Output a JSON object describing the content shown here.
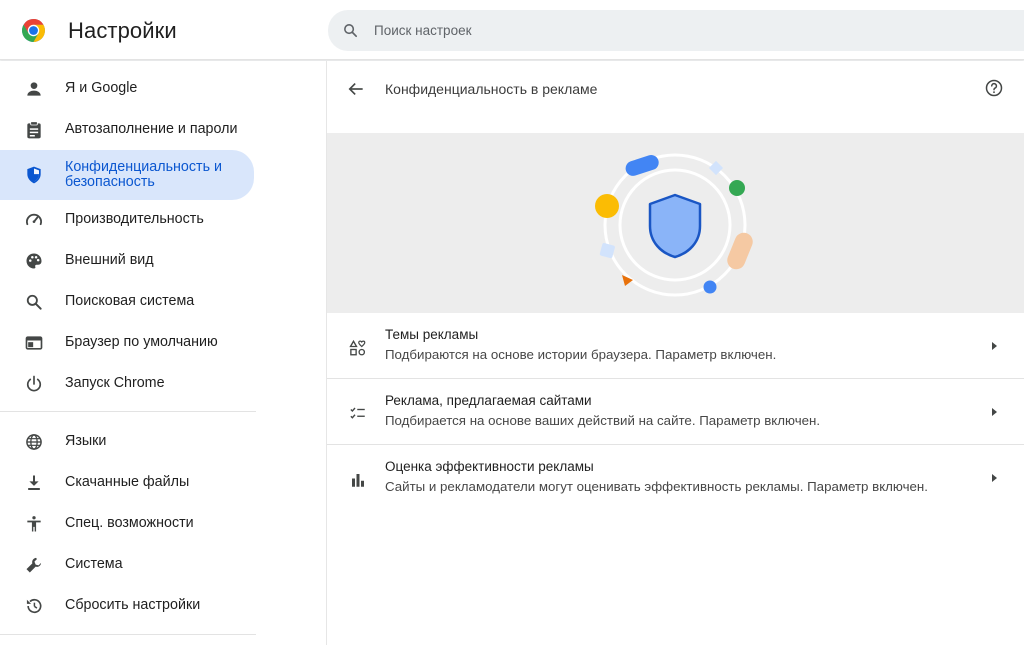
{
  "header": {
    "title": "Настройки",
    "search_placeholder": "Поиск настроек"
  },
  "sidebar": {
    "items": [
      {
        "label": "Я и Google",
        "icon": "person-icon"
      },
      {
        "label": "Автозаполнение и пароли",
        "icon": "clipboard-icon"
      },
      {
        "label": "Конфиденциальность и безопасность",
        "icon": "shield-icon",
        "active": true
      },
      {
        "label": "Производительность",
        "icon": "speedometer-icon"
      },
      {
        "label": "Внешний вид",
        "icon": "palette-icon"
      },
      {
        "label": "Поисковая система",
        "icon": "search-icon"
      },
      {
        "label": "Браузер по умолчанию",
        "icon": "browser-window-icon"
      },
      {
        "label": "Запуск Chrome",
        "icon": "power-icon"
      },
      {
        "label": "Языки",
        "icon": "globe-icon"
      },
      {
        "label": "Скачанные файлы",
        "icon": "download-icon"
      },
      {
        "label": "Спец. возможности",
        "icon": "accessibility-icon"
      },
      {
        "label": "Система",
        "icon": "wrench-icon"
      },
      {
        "label": "Сбросить настройки",
        "icon": "history-icon"
      }
    ]
  },
  "main": {
    "title": "Конфиденциальность в рекламе",
    "rows": [
      {
        "title": "Темы рекламы",
        "subtitle": "Подбираются на основе истории браузера. Параметр включен.",
        "icon": "ad-topics-icon"
      },
      {
        "title": "Реклама, предлагаемая сайтами",
        "subtitle": "Подбирается на основе ваших действий на сайте. Параметр включен.",
        "icon": "checklist-icon"
      },
      {
        "title": "Оценка эффективности рекламы",
        "subtitle": "Сайты и рекламодатели могут оценивать эффективность рекламы. Параметр включен.",
        "icon": "bar-chart-icon"
      }
    ]
  },
  "colors": {
    "accent": "#0b57d0",
    "active_bg": "#d9e6fb",
    "shield_fill": "#8ab4f8",
    "shield_stroke": "#1a56c4",
    "google_blue": "#4285f4",
    "google_green": "#34a853",
    "google_yellow": "#fbbc04",
    "google_red": "#ea4335",
    "peach": "#f5c9a3",
    "orange": "#e8710a"
  }
}
